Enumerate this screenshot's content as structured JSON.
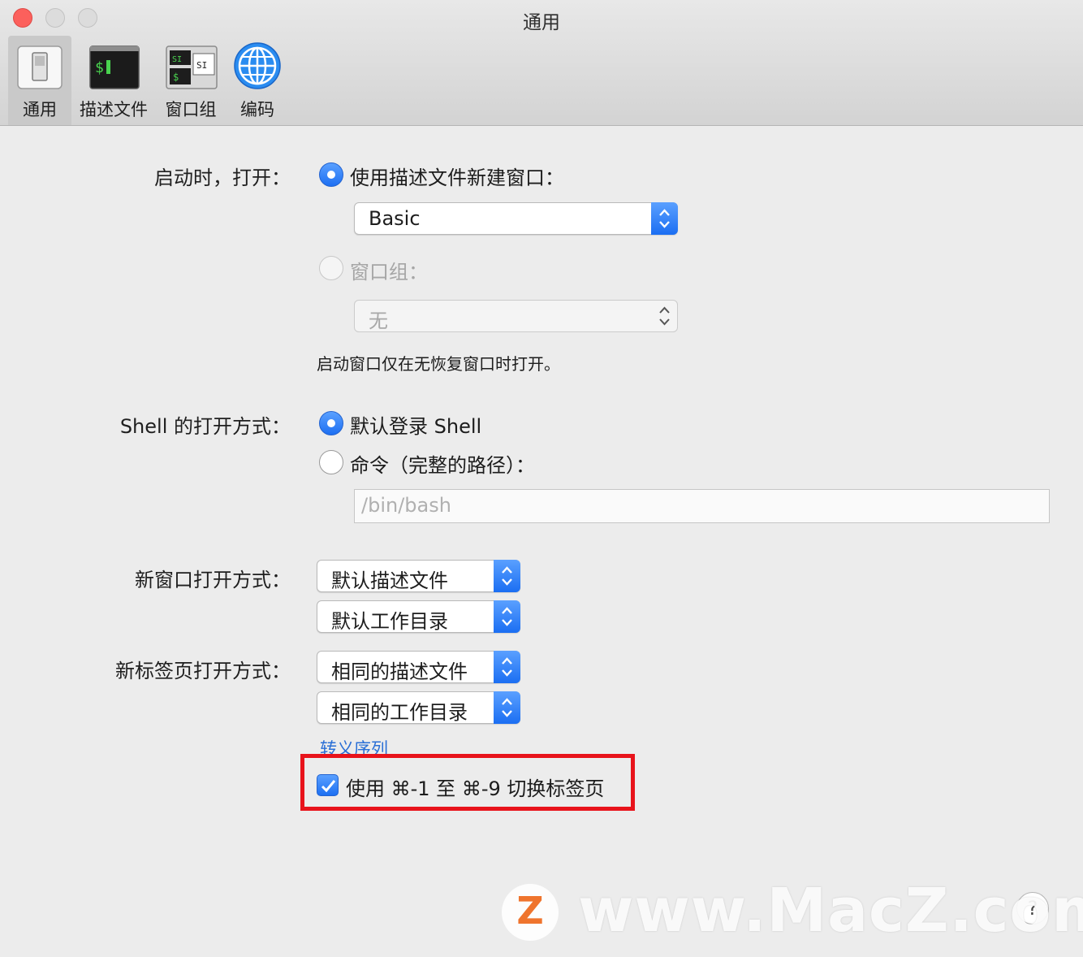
{
  "window": {
    "title": "通用"
  },
  "toolbar": {
    "items": [
      {
        "label": "通用",
        "icon": "general-switch-icon",
        "active": true
      },
      {
        "label": "描述文件",
        "icon": "terminal-profile-icon",
        "active": false
      },
      {
        "label": "窗口组",
        "icon": "window-groups-icon",
        "active": false
      },
      {
        "label": "编码",
        "icon": "globe-icon",
        "active": false
      }
    ],
    "terminal_glyph": "$",
    "window_glyph_1": "SI",
    "window_glyph_2": "SI",
    "window_glyph_3": "$"
  },
  "startup": {
    "label": "启动时，打开：",
    "profile_option": "使用描述文件新建窗口：",
    "profile_value": "Basic",
    "group_option": "窗口组：",
    "group_value": "无",
    "note": "启动窗口仅在无恢复窗口时打开。"
  },
  "shell": {
    "label": "Shell 的打开方式：",
    "default_option": "默认登录 Shell",
    "command_option": "命令（完整的路径）：",
    "command_placeholder": "/bin/bash"
  },
  "new_window": {
    "label": "新窗口打开方式：",
    "profile_value": "默认描述文件",
    "directory_value": "默认工作目录"
  },
  "new_tab": {
    "label": "新标签页打开方式：",
    "profile_value": "相同的描述文件",
    "directory_value": "相同的工作目录"
  },
  "escape_link": "转义序列",
  "tab_switch_checkbox": {
    "label": "使用 ⌘-1 至 ⌘-9 切换标签页",
    "checked": true
  },
  "watermark": {
    "logo_letter": "Z",
    "text": "www.MacZ.com"
  },
  "help_label": "?",
  "colors": {
    "accent": "#1d6ff2",
    "highlight": "#e8131b",
    "watermark_orange": "#f06a1d"
  }
}
